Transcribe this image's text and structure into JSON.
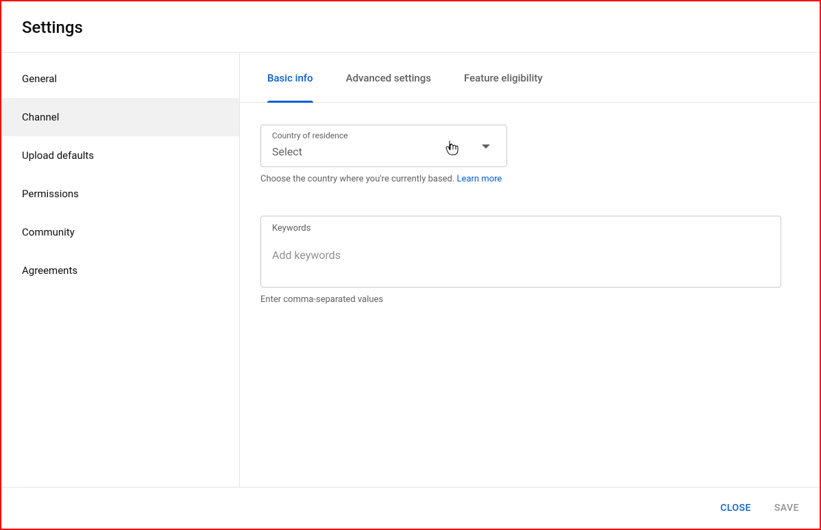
{
  "header": {
    "title": "Settings"
  },
  "sidebar": {
    "items": [
      {
        "label": "General",
        "selected": false
      },
      {
        "label": "Channel",
        "selected": true
      },
      {
        "label": "Upload defaults",
        "selected": false
      },
      {
        "label": "Permissions",
        "selected": false
      },
      {
        "label": "Community",
        "selected": false
      },
      {
        "label": "Agreements",
        "selected": false
      }
    ]
  },
  "tabs": [
    {
      "label": "Basic info",
      "active": true
    },
    {
      "label": "Advanced settings",
      "active": false
    },
    {
      "label": "Feature eligibility",
      "active": false
    }
  ],
  "country": {
    "label": "Country of residence",
    "value": "Select",
    "helper": "Choose the country where you're currently based. ",
    "learn_more": "Learn more"
  },
  "keywords": {
    "label": "Keywords",
    "placeholder": "Add keywords",
    "value": "",
    "helper": "Enter comma-separated values"
  },
  "footer": {
    "close": "CLOSE",
    "save": "SAVE"
  }
}
